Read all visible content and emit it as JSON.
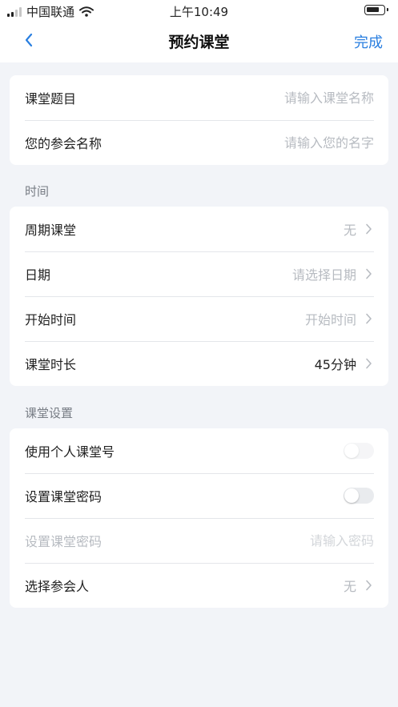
{
  "status_bar": {
    "carrier": "中国联通",
    "time": "上午10:49"
  },
  "nav": {
    "title": "预约课堂",
    "done_label": "完成"
  },
  "basic_info": {
    "topic_label": "课堂题目",
    "topic_placeholder": "请输入课堂名称",
    "name_label": "您的参会名称",
    "name_placeholder": "请输入您的名字"
  },
  "time_section": {
    "header": "时间",
    "recurring_label": "周期课堂",
    "recurring_value": "无",
    "date_label": "日期",
    "date_placeholder": "请选择日期",
    "start_label": "开始时间",
    "start_placeholder": "开始时间",
    "duration_label": "课堂时长",
    "duration_value": "45分钟"
  },
  "settings_section": {
    "header": "课堂设置",
    "personal_id_label": "使用个人课堂号",
    "personal_id_enabled": false,
    "password_toggle_label": "设置课堂密码",
    "password_enabled": false,
    "password_field_label": "设置课堂密码",
    "password_placeholder": "请输入密码",
    "participants_label": "选择参会人",
    "participants_value": "无"
  },
  "colors": {
    "accent": "#2a7fe0",
    "background": "#f2f4f8"
  },
  "icons": {
    "back": "chevron-left-icon",
    "row_arrow": "chevron-right-icon",
    "wifi": "wifi-icon",
    "signal": "signal-icon",
    "battery": "battery-icon"
  }
}
